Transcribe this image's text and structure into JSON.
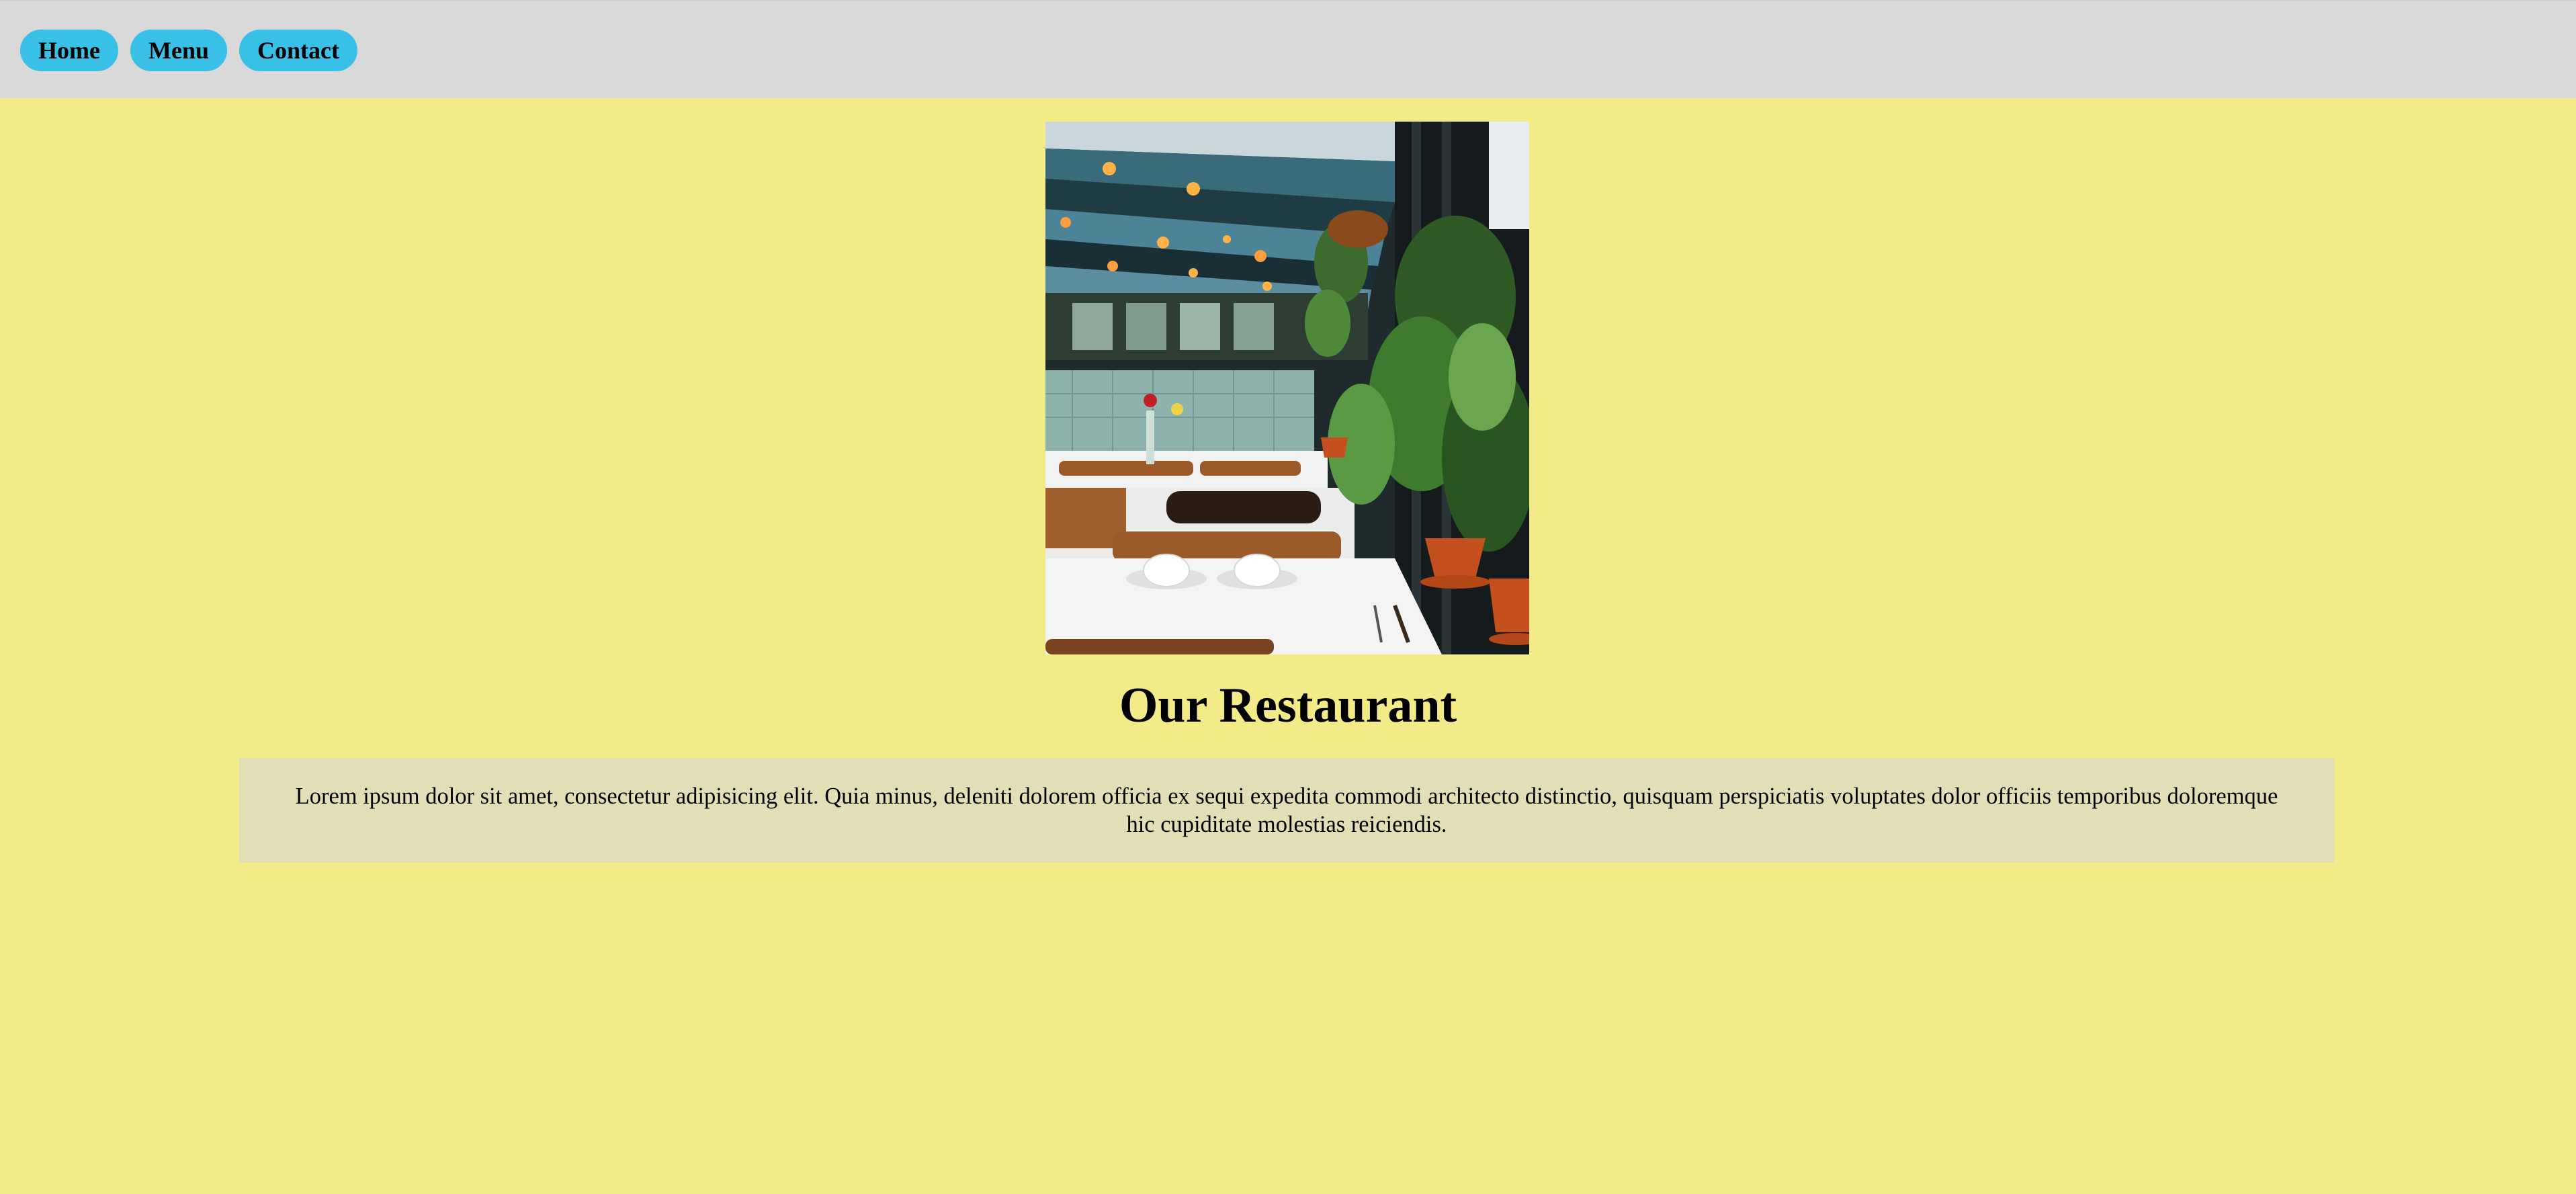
{
  "nav": {
    "home": "Home",
    "menu": "Menu",
    "contact": "Contact"
  },
  "hero": {
    "image_alt": "restaurant-interior-photo"
  },
  "main": {
    "title": "Our Restaurant",
    "description": "Lorem ipsum dolor sit amet, consectetur adipisicing elit. Quia minus, deleniti dolorem officia ex sequi expedita commodi architecto distinctio, quisquam perspiciatis voluptates dolor officiis temporibus doloremque hic cupiditate molestias reiciendis."
  },
  "colors": {
    "page_background": "#f2eb87",
    "topbar_background": "#d9d9d9",
    "nav_button": "#38c0e6",
    "description_box": "#e2dfb6"
  }
}
